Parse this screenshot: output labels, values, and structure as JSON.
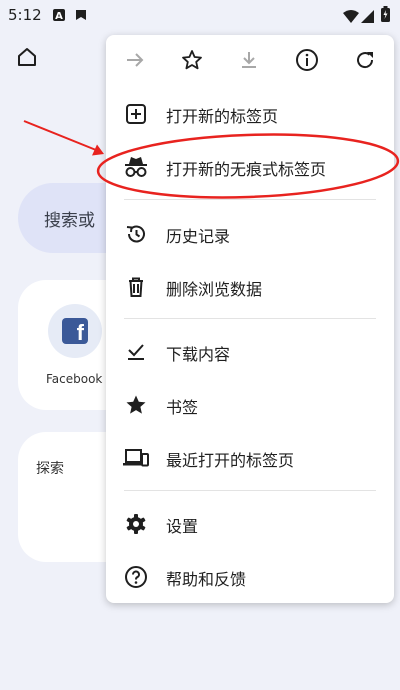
{
  "status_bar": {
    "time": "5:12",
    "icons": [
      "notification-a-icon",
      "notification-b-icon",
      "wifi-icon",
      "signal-icon",
      "battery-icon"
    ]
  },
  "page": {
    "search_placeholder": "搜索或",
    "shortcut_label": "Facebook",
    "discover_label": "探索"
  },
  "menu": {
    "toolbar": [
      "forward-icon",
      "bookmark-star-icon",
      "download-icon",
      "info-icon",
      "refresh-icon"
    ],
    "items": [
      {
        "label": "打开新的标签页",
        "icon": "new-tab-icon"
      },
      {
        "label": "打开新的无痕式标签页",
        "icon": "incognito-icon"
      },
      {
        "label": "历史记录",
        "icon": "history-icon"
      },
      {
        "label": "删除浏览数据",
        "icon": "trash-icon"
      },
      {
        "label": "下载内容",
        "icon": "downloads-icon"
      },
      {
        "label": "书签",
        "icon": "bookmarks-icon"
      },
      {
        "label": "最近打开的标签页",
        "icon": "recent-tabs-icon"
      },
      {
        "label": "设置",
        "icon": "settings-icon"
      },
      {
        "label": "帮助和反馈",
        "icon": "help-icon"
      }
    ]
  },
  "colors": {
    "background": "#eff1f9",
    "annotation_red": "#e8231f",
    "facebook_blue": "#3b5998"
  }
}
